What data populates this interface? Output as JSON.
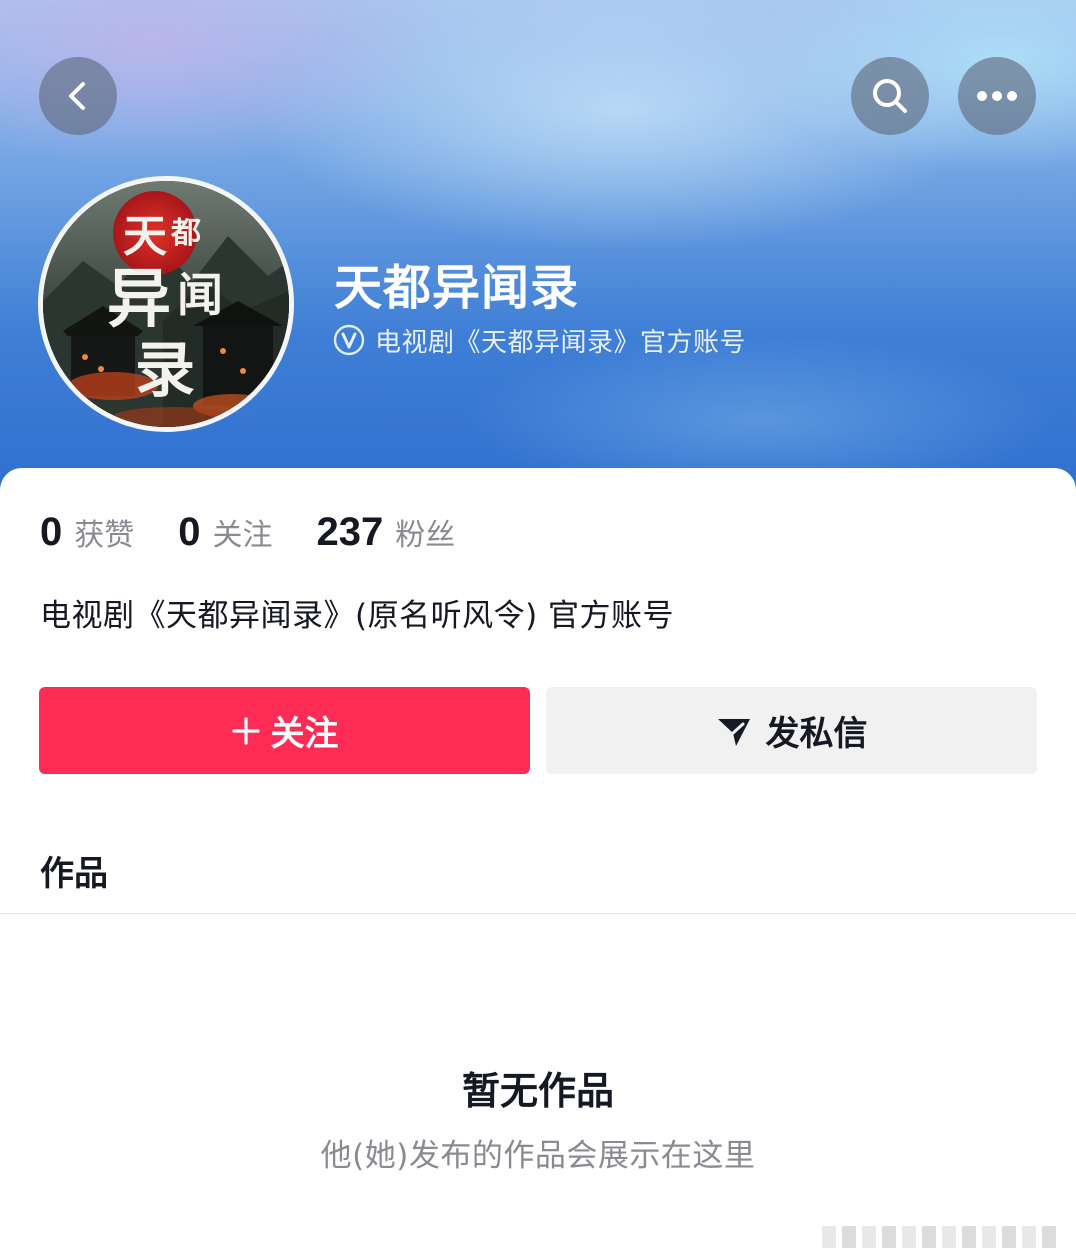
{
  "header": {
    "back_icon": "chevron-left-icon",
    "search_icon": "search-icon",
    "more_icon": "more-horizontal-icon"
  },
  "profile": {
    "avatar_title": "天都异闻录",
    "name": "天都异闻录",
    "verified_icon": "verified-v-icon",
    "verified_text": "电视剧《天都异闻录》官方账号"
  },
  "stats": [
    {
      "value": "0",
      "label": "获赞"
    },
    {
      "value": "0",
      "label": "关注"
    },
    {
      "value": "237",
      "label": "粉丝"
    }
  ],
  "bio": "电视剧《天都异闻录》(原名听风令) 官方账号",
  "actions": {
    "follow_label": "关注",
    "message_label": "发私信"
  },
  "tabs": {
    "works_label": "作品"
  },
  "empty_state": {
    "title": "暂无作品",
    "subtitle": "他(她)发布的作品会展示在这里"
  },
  "colors": {
    "accent": "#fe2c55",
    "secondary_button": "#f1f1f2",
    "header_blue": "#3f7fd6",
    "muted_text": "#8a8b91"
  }
}
